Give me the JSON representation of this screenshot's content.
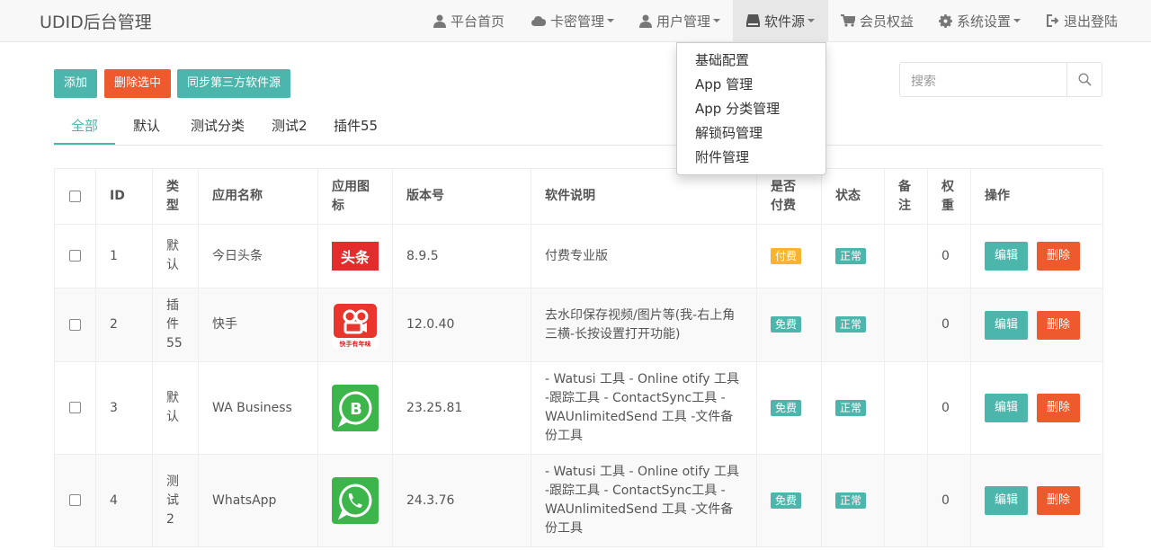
{
  "app": {
    "title": "UDID后台管理"
  },
  "nav": {
    "items": [
      {
        "label": "平台首页",
        "icon": "user-icon"
      },
      {
        "label": "卡密管理",
        "icon": "cloud-icon",
        "dropdown": true
      },
      {
        "label": "用户管理",
        "icon": "user-icon",
        "dropdown": true
      },
      {
        "label": "软件源",
        "icon": "hdd-icon",
        "dropdown": true,
        "active": true
      },
      {
        "label": "会员权益",
        "icon": "cart-icon"
      },
      {
        "label": "系统设置",
        "icon": "gear-icon",
        "dropdown": true
      },
      {
        "label": "退出登陆",
        "icon": "logout-icon"
      }
    ],
    "dropdown_items": [
      "基础配置",
      "App 管理",
      "App 分类管理",
      "解锁码管理",
      "附件管理"
    ]
  },
  "toolbar": {
    "add_label": "添加",
    "delete_selected_label": "删除选中",
    "sync_label": "同步第三方软件源",
    "search_placeholder": "搜索"
  },
  "tabs": [
    "全部",
    "默认",
    "测试分类",
    "测试2",
    "插件55"
  ],
  "table": {
    "headers": {
      "id": "ID",
      "type": "类型",
      "name": "应用名称",
      "icon": "应用图标",
      "version": "版本号",
      "desc": "软件说明",
      "paid": "是否付费",
      "status": "状态",
      "note": "备注",
      "weight": "权重",
      "actions": "操作"
    },
    "edit_label": "编辑",
    "delete_label": "删除",
    "rows": [
      {
        "id": "1",
        "type": "默认",
        "name": "今日头条",
        "icon": "toutiao-icon",
        "version": "8.9.5",
        "desc": "付费专业版",
        "paid": "付费",
        "status": "正常",
        "note": "",
        "weight": "0"
      },
      {
        "id": "2",
        "type": "插件55",
        "name": "快手",
        "icon": "kuaishou-icon",
        "version": "12.0.40",
        "desc": "去水印保存视频/图片等(我-右上角三横-长按设置打开功能)",
        "paid": "免费",
        "status": "正常",
        "note": "",
        "weight": "0"
      },
      {
        "id": "3",
        "type": "默认",
        "name": "WA Business",
        "icon": "wa-business-icon",
        "version": "23.25.81",
        "desc": "- Watusi 工具 - Online otify 工具 -跟踪工具 - ContactSync工具 -WAUnlimitedSend 工具 -文件备份工具",
        "paid": "免费",
        "status": "正常",
        "note": "",
        "weight": "0"
      },
      {
        "id": "4",
        "type": "测试2",
        "name": "WhatsApp",
        "icon": "whatsapp-icon",
        "version": "24.3.76",
        "desc": "- Watusi 工具 - Online otify 工具 -跟踪工具 - ContactSync工具 -WAUnlimitedSend 工具 -文件备份工具",
        "paid": "免费",
        "status": "正常",
        "note": "",
        "weight": "0"
      }
    ],
    "kuaishou_icon_text": "快手有年味",
    "toutiao_icon_text": "头条"
  }
}
